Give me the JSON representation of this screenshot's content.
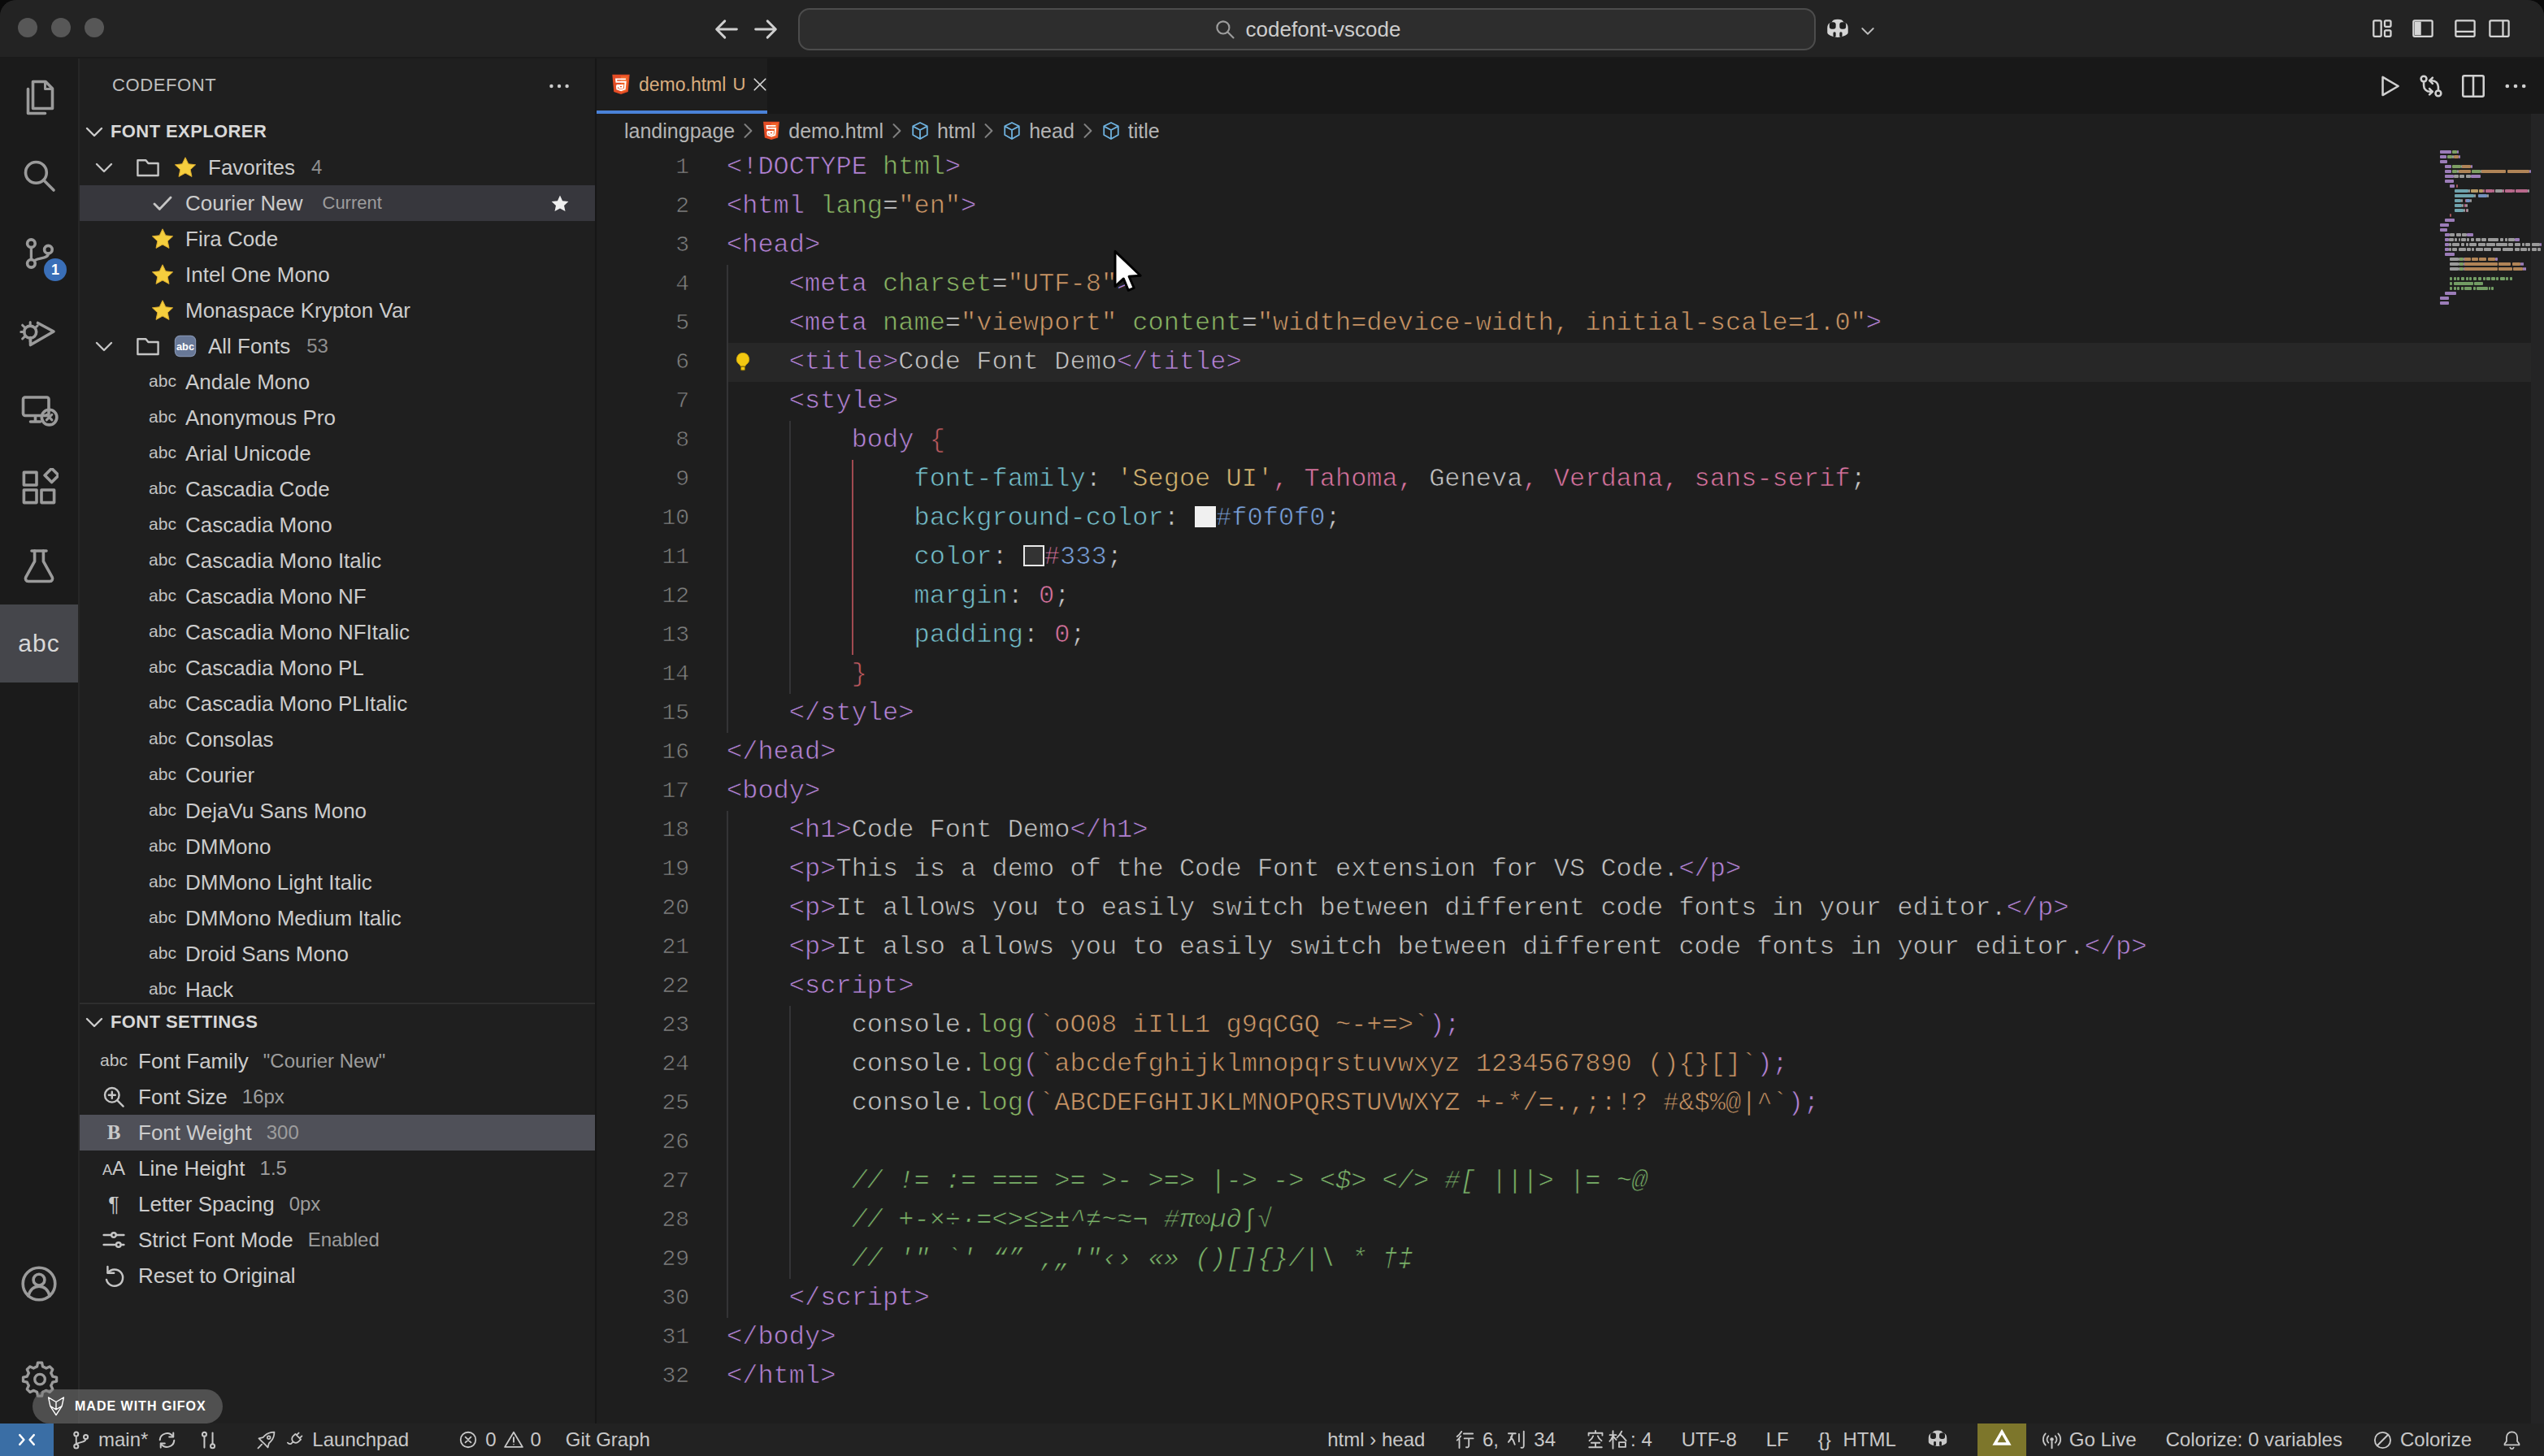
{
  "colors": {
    "tag": "#b584d8",
    "attr": "#8ab764",
    "string": "#ce9867",
    "prop": "#74bfcb",
    "pink": "#d9739f",
    "yellow": "#d8b672",
    "blue": "#7aa2dd",
    "red": "#c05a60",
    "comment": "#7cb56a",
    "fg": "#c6c6c6",
    "punct": "#c8c8c8",
    "accent_blue_tab": "#4a82d8",
    "remote_badge_bg": "#3a6ea5",
    "gold_badge_bg": "#7d762b",
    "swatch_light": "#f0f0f0",
    "swatch_dark": "#333333"
  },
  "titlebar": {
    "search_query": "codefont-vscode",
    "icons_right": [
      "customize-layout",
      "panel-left",
      "panel-bottom",
      "panel-right"
    ],
    "copilot_menu": "copilot"
  },
  "activity_bar": {
    "items": [
      {
        "id": "explorer",
        "icon": "files-icon"
      },
      {
        "id": "search",
        "icon": "search-icon"
      },
      {
        "id": "source-control",
        "icon": "source-control-icon",
        "badge": "1"
      },
      {
        "id": "run-debug",
        "icon": "debug-icon"
      },
      {
        "id": "remote-explorer",
        "icon": "remote-icon"
      },
      {
        "id": "extensions",
        "icon": "extensions-icon"
      },
      {
        "id": "testing",
        "icon": "beaker-icon"
      },
      {
        "id": "codefont",
        "icon": "abc-text",
        "active": true
      }
    ],
    "bottom_items": [
      {
        "id": "accounts",
        "icon": "account-icon"
      },
      {
        "id": "settings",
        "icon": "gear-icon"
      }
    ]
  },
  "sidebar": {
    "title": "CODEFONT",
    "explorer_section": "FONT EXPLORER",
    "tree": [
      {
        "kind": "folder",
        "label": "Favorites",
        "count": "4",
        "emoji": "star"
      },
      {
        "kind": "item",
        "label": "Courier New",
        "badge": "Current",
        "icon": "check",
        "selected": true,
        "trail": "star-filled"
      },
      {
        "kind": "item",
        "label": "Fira Code",
        "icon": "star"
      },
      {
        "kind": "item",
        "label": "Intel One Mono",
        "icon": "star"
      },
      {
        "kind": "item",
        "label": "Monaspace Krypton Var",
        "icon": "star"
      },
      {
        "kind": "folder",
        "label": "All Fonts",
        "count": "53",
        "emoji": "abc-emoji"
      },
      {
        "kind": "item",
        "label": "Andale Mono",
        "icon": "abc"
      },
      {
        "kind": "item",
        "label": "Anonymous Pro",
        "icon": "abc"
      },
      {
        "kind": "item",
        "label": "Arial Unicode",
        "icon": "abc"
      },
      {
        "kind": "item",
        "label": "Cascadia Code",
        "icon": "abc"
      },
      {
        "kind": "item",
        "label": "Cascadia Mono",
        "icon": "abc"
      },
      {
        "kind": "item",
        "label": "Cascadia Mono Italic",
        "icon": "abc"
      },
      {
        "kind": "item",
        "label": "Cascadia Mono NF",
        "icon": "abc"
      },
      {
        "kind": "item",
        "label": "Cascadia Mono NFItalic",
        "icon": "abc"
      },
      {
        "kind": "item",
        "label": "Cascadia Mono PL",
        "icon": "abc"
      },
      {
        "kind": "item",
        "label": "Cascadia Mono PLItalic",
        "icon": "abc"
      },
      {
        "kind": "item",
        "label": "Consolas",
        "icon": "abc"
      },
      {
        "kind": "item",
        "label": "Courier",
        "icon": "abc"
      },
      {
        "kind": "item",
        "label": "DejaVu Sans Mono",
        "icon": "abc"
      },
      {
        "kind": "item",
        "label": "DMMono",
        "icon": "abc"
      },
      {
        "kind": "item",
        "label": "DMMono Light Italic",
        "icon": "abc"
      },
      {
        "kind": "item",
        "label": "DMMono Medium Italic",
        "icon": "abc"
      },
      {
        "kind": "item",
        "label": "Droid Sans Mono",
        "icon": "abc"
      },
      {
        "kind": "item",
        "label": "Hack",
        "icon": "abc"
      }
    ],
    "settings_section": "FONT SETTINGS",
    "settings": [
      {
        "label": "Font Family",
        "value": "\"Courier New\"",
        "icon": "abc"
      },
      {
        "label": "Font Size",
        "value": "16px",
        "icon": "zoom-in"
      },
      {
        "label": "Font Weight",
        "value": "300",
        "icon": "bold-b",
        "selected": true
      },
      {
        "label": "Line Height",
        "value": "1.5",
        "icon": "line-height"
      },
      {
        "label": "Letter Spacing",
        "value": "0px",
        "icon": "pilcrow"
      },
      {
        "label": "Strict Font Mode",
        "value": "Enabled",
        "icon": "sliders"
      },
      {
        "label": "Reset to Original",
        "value": "",
        "icon": "reset"
      }
    ]
  },
  "gifox_badge": {
    "label": "MADE WITH GIFOX",
    "icon": "fox-icon"
  },
  "editor": {
    "tab": {
      "label": "demo.html",
      "modified_marker": "U",
      "icon": "html5-icon"
    },
    "actions": [
      "run",
      "open-changes",
      "split-editor",
      "more"
    ],
    "breadcrumbs": [
      {
        "label": "landingpage"
      },
      {
        "label": "demo.html",
        "icon": "html5-icon"
      },
      {
        "label": "html",
        "icon": "symbol-cube"
      },
      {
        "label": "head",
        "icon": "symbol-cube"
      },
      {
        "label": "title",
        "icon": "symbol-cube"
      }
    ],
    "current_line": 6,
    "lightbulb_line": 6,
    "guides": [
      {
        "col": 0,
        "from": 4,
        "to": 15,
        "kind": "gray"
      },
      {
        "col": 4,
        "from": 8,
        "to": 14,
        "kind": "gray"
      },
      {
        "col": 8,
        "from": 9,
        "to": 13,
        "kind": "red"
      },
      {
        "col": 0,
        "from": 18,
        "to": 30,
        "kind": "gray"
      },
      {
        "col": 4,
        "from": 23,
        "to": 29,
        "kind": "gray"
      }
    ],
    "code_lines": [
      {
        "n": 1,
        "tokens": [
          [
            "<!DOCTYPE",
            "tag"
          ],
          [
            " html",
            "attr"
          ],
          [
            ">",
            "tag"
          ]
        ]
      },
      {
        "n": 2,
        "tokens": [
          [
            "<html",
            "tag"
          ],
          [
            " lang",
            "attr"
          ],
          [
            "=",
            "punct"
          ],
          [
            "\"en\"",
            "string"
          ],
          [
            ">",
            "tag"
          ]
        ]
      },
      {
        "n": 3,
        "tokens": [
          [
            "<head>",
            "tag"
          ]
        ]
      },
      {
        "n": 4,
        "tokens": [
          [
            "    ",
            "ws"
          ],
          [
            "<meta",
            "tag"
          ],
          [
            " charset",
            "attr"
          ],
          [
            "=",
            "punct"
          ],
          [
            "\"UTF-8\"",
            "string"
          ],
          [
            ">",
            "tag"
          ]
        ]
      },
      {
        "n": 5,
        "tokens": [
          [
            "    ",
            "ws"
          ],
          [
            "<meta",
            "tag"
          ],
          [
            " name",
            "attr"
          ],
          [
            "=",
            "punct"
          ],
          [
            "\"viewport\"",
            "string"
          ],
          [
            " content",
            "attr"
          ],
          [
            "=",
            "punct"
          ],
          [
            "\"width=device-width, initial-scale=1.0\"",
            "string"
          ],
          [
            ">",
            "tag"
          ]
        ]
      },
      {
        "n": 6,
        "tokens": [
          [
            "    ",
            "ws"
          ],
          [
            "<title>",
            "tag"
          ],
          [
            "Code Font Demo",
            "fg"
          ],
          [
            "</title>",
            "tag"
          ]
        ]
      },
      {
        "n": 7,
        "tokens": [
          [
            "    ",
            "ws"
          ],
          [
            "<style>",
            "tag"
          ]
        ]
      },
      {
        "n": 8,
        "tokens": [
          [
            "        ",
            "ws"
          ],
          [
            "body",
            "tag"
          ],
          [
            " ",
            "ws"
          ],
          [
            "{",
            "red"
          ]
        ]
      },
      {
        "n": 9,
        "tokens": [
          [
            "            ",
            "ws"
          ],
          [
            "font-family",
            "prop"
          ],
          [
            ":",
            "punct"
          ],
          [
            " ",
            "ws"
          ],
          [
            "'Segoe UI'",
            "yellow"
          ],
          [
            ",",
            "pink"
          ],
          [
            " Tahoma",
            "pink"
          ],
          [
            ",",
            "pink"
          ],
          [
            " Geneva",
            "fg"
          ],
          [
            ",",
            "pink"
          ],
          [
            " Verdana",
            "pink"
          ],
          [
            ",",
            "pink"
          ],
          [
            " sans-serif",
            "pink"
          ],
          [
            ";",
            "punct"
          ]
        ]
      },
      {
        "n": 10,
        "tokens": [
          [
            "            ",
            "ws"
          ],
          [
            "background-color",
            "prop"
          ],
          [
            ":",
            "punct"
          ],
          [
            " ",
            "ws"
          ],
          [
            "",
            "swatch-light"
          ],
          [
            "#f0f0f0",
            "blue"
          ],
          [
            ";",
            "punct"
          ]
        ]
      },
      {
        "n": 11,
        "tokens": [
          [
            "            ",
            "ws"
          ],
          [
            "color",
            "prop"
          ],
          [
            ":",
            "punct"
          ],
          [
            " ",
            "ws"
          ],
          [
            "",
            "swatch-dark"
          ],
          [
            "#",
            "pink"
          ],
          [
            "333",
            "blue"
          ],
          [
            ";",
            "punct"
          ]
        ]
      },
      {
        "n": 12,
        "tokens": [
          [
            "            ",
            "ws"
          ],
          [
            "margin",
            "prop"
          ],
          [
            ":",
            "punct"
          ],
          [
            " ",
            "ws"
          ],
          [
            "0",
            "pink"
          ],
          [
            ";",
            "punct"
          ]
        ]
      },
      {
        "n": 13,
        "tokens": [
          [
            "            ",
            "ws"
          ],
          [
            "padding",
            "prop"
          ],
          [
            ":",
            "punct"
          ],
          [
            " ",
            "ws"
          ],
          [
            "0",
            "pink"
          ],
          [
            ";",
            "punct"
          ]
        ]
      },
      {
        "n": 14,
        "tokens": [
          [
            "        ",
            "ws"
          ],
          [
            "}",
            "red"
          ]
        ]
      },
      {
        "n": 15,
        "tokens": [
          [
            "    ",
            "ws"
          ],
          [
            "</style>",
            "tag"
          ]
        ]
      },
      {
        "n": 16,
        "tokens": [
          [
            "</head>",
            "tag"
          ]
        ]
      },
      {
        "n": 17,
        "tokens": [
          [
            "<body>",
            "tag"
          ]
        ]
      },
      {
        "n": 18,
        "tokens": [
          [
            "    ",
            "ws"
          ],
          [
            "<h1>",
            "tag"
          ],
          [
            "Code Font Demo",
            "fg"
          ],
          [
            "</h1>",
            "tag"
          ]
        ]
      },
      {
        "n": 19,
        "tokens": [
          [
            "    ",
            "ws"
          ],
          [
            "<p>",
            "tag"
          ],
          [
            "This is a demo of the Code Font extension for VS Code.",
            "fg"
          ],
          [
            "</p>",
            "tag"
          ]
        ]
      },
      {
        "n": 20,
        "tokens": [
          [
            "    ",
            "ws"
          ],
          [
            "<p>",
            "tag"
          ],
          [
            "It allows you to easily switch between different code fonts in your editor.",
            "fg"
          ],
          [
            "</p>",
            "tag"
          ]
        ]
      },
      {
        "n": 21,
        "tokens": [
          [
            "    ",
            "ws"
          ],
          [
            "<p>",
            "tag"
          ],
          [
            "It also allows you to easily switch between different code fonts in your editor.",
            "fg"
          ],
          [
            "</p>",
            "tag"
          ]
        ]
      },
      {
        "n": 22,
        "tokens": [
          [
            "    ",
            "ws"
          ],
          [
            "<script>",
            "tag"
          ]
        ]
      },
      {
        "n": 23,
        "tokens": [
          [
            "        ",
            "ws"
          ],
          [
            "console",
            "fg"
          ],
          [
            ".",
            "punct"
          ],
          [
            "log",
            "attr"
          ],
          [
            "(",
            "tag"
          ],
          [
            "`oO08 iIlL1 g9qCGQ ~-+=>`",
            "string"
          ],
          [
            ")",
            "tag"
          ],
          [
            ";",
            "tag"
          ]
        ]
      },
      {
        "n": 24,
        "tokens": [
          [
            "        ",
            "ws"
          ],
          [
            "console",
            "fg"
          ],
          [
            ".",
            "punct"
          ],
          [
            "log",
            "attr"
          ],
          [
            "(",
            "tag"
          ],
          [
            "`abcdefghijklmnopqrstuvwxyz 1234567890 (){}[]`",
            "string"
          ],
          [
            ")",
            "tag"
          ],
          [
            ";",
            "tag"
          ]
        ]
      },
      {
        "n": 25,
        "tokens": [
          [
            "        ",
            "ws"
          ],
          [
            "console",
            "fg"
          ],
          [
            ".",
            "punct"
          ],
          [
            "log",
            "attr"
          ],
          [
            "(",
            "tag"
          ],
          [
            "`ABCDEFGHIJKLMNOPQRSTUVWXYZ +-*/=.,;:!? #&$%@|^`",
            "string"
          ],
          [
            ")",
            "tag"
          ],
          [
            ";",
            "tag"
          ]
        ]
      },
      {
        "n": 26,
        "tokens": []
      },
      {
        "n": 27,
        "tokens": [
          [
            "        ",
            "ws"
          ],
          [
            "// != := === >= >- >=> |-> -> <$> </> #[ |||> |= ~@",
            "comment"
          ]
        ]
      },
      {
        "n": 28,
        "tokens": [
          [
            "        ",
            "ws"
          ],
          [
            "// +-×÷·=<>≤≥±^≠~≈¬ #π∞µ∂∫√",
            "comment"
          ]
        ]
      },
      {
        "n": 29,
        "tokens": [
          [
            "        ",
            "ws"
          ],
          [
            "// '\" `' “” ‚„'\"‹› «» ()[]{}/|\\ * †‡",
            "comment"
          ]
        ]
      },
      {
        "n": 30,
        "tokens": [
          [
            "    ",
            "ws"
          ],
          [
            "</script>",
            "tag"
          ]
        ]
      },
      {
        "n": 31,
        "tokens": [
          [
            "</body>",
            "tag"
          ]
        ]
      },
      {
        "n": 32,
        "tokens": [
          [
            "</html>",
            "tag"
          ]
        ]
      }
    ]
  },
  "status_bar": {
    "left": [
      {
        "id": "remote",
        "icon": "remote-brackets",
        "type": "remote-badge"
      },
      {
        "id": "branch",
        "icon": "git-branch-icon",
        "label": "main*",
        "ml": 10
      },
      {
        "id": "sync",
        "icon": "sync-icon",
        "ml": 5
      },
      {
        "id": "graph",
        "icon": "graph-icon",
        "ml": 12
      },
      {
        "id": "launchpad",
        "icons": [
          "rocket-icon",
          "plug-icon"
        ],
        "label": "Launchpad",
        "ml": 22
      },
      {
        "id": "problems",
        "pairs": [
          [
            "error-icon",
            "0"
          ],
          [
            "warning-icon",
            "0"
          ]
        ],
        "ml": 30
      },
      {
        "id": "git-graph",
        "label": "Git Graph",
        "ml": 15
      }
    ],
    "right": [
      {
        "id": "symbol-path",
        "label": "html › head"
      },
      {
        "id": "cursor-position",
        "cjk": true,
        "parts": [
          [
            "svg",
            "hang"
          ],
          [
            "txt",
            " 6, "
          ],
          [
            "svg",
            "lie"
          ],
          [
            "txt",
            " 34"
          ]
        ]
      },
      {
        "id": "indentation",
        "cjk": true,
        "parts": [
          [
            "svg",
            "kong"
          ],
          [
            "svg",
            "ge"
          ],
          [
            "txt",
            ": 4"
          ]
        ]
      },
      {
        "id": "encoding",
        "label": "UTF-8"
      },
      {
        "id": "eol",
        "label": "LF"
      },
      {
        "id": "language",
        "label": "HTML",
        "prefix": "{} "
      },
      {
        "id": "copilot",
        "icon": "copilot"
      },
      {
        "id": "extension-badge",
        "icon": "knot-icon",
        "type": "gold-badge"
      },
      {
        "id": "go-live",
        "icon": "broadcast-icon",
        "label": "Go Live"
      },
      {
        "id": "colorize-vars",
        "label": "Colorize: 0 variables"
      },
      {
        "id": "colorize",
        "icon": "slash-circle-icon",
        "label": "Colorize"
      },
      {
        "id": "notifications",
        "icon": "bell-icon"
      }
    ]
  }
}
